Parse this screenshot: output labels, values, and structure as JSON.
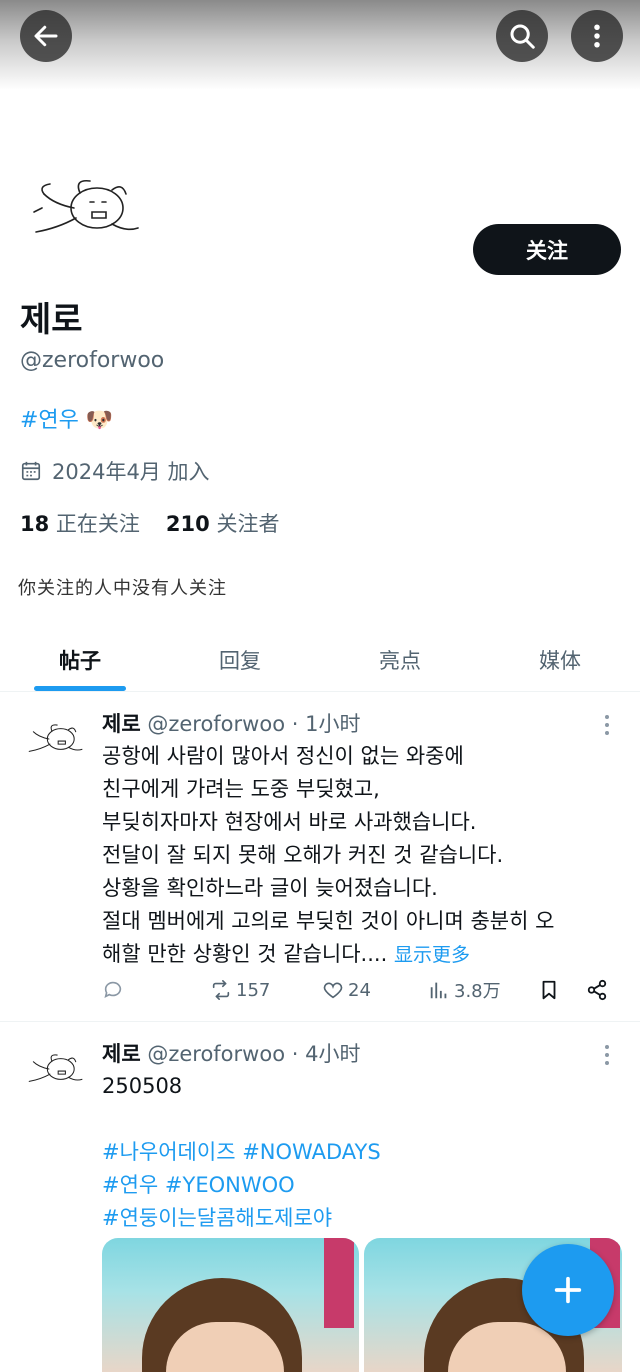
{
  "header": {
    "back_icon": "arrow-left-icon",
    "search_icon": "search-icon",
    "more_icon": "more-vertical-icon"
  },
  "profile": {
    "name": "제로",
    "handle": "@zeroforwoo",
    "bio_tag": "#연우",
    "bio_emoji": "🐶",
    "joined": "2024年4月 加入",
    "following_count": "18",
    "following_label": "正在关注",
    "followers_count": "210",
    "followers_label": "关注者",
    "followers_note": "你关注的人中没有人关注",
    "follow_label": "关注"
  },
  "tabs": [
    {
      "label": "帖子",
      "active": true
    },
    {
      "label": "回复",
      "active": false
    },
    {
      "label": "亮点",
      "active": false
    },
    {
      "label": "媒体",
      "active": false
    }
  ],
  "posts": [
    {
      "name": "제로",
      "handle": "@zeroforwoo",
      "time": "· 1小时",
      "lines": [
        "공항에 사람이 많아서 정신이 없는 와중에",
        "친구에게 가려는 도중 부딪혔고,",
        "부딪히자마자 현장에서 바로 사과했습니다.",
        "전달이 잘 되지 못해 오해가 커진 것 같습니다.",
        "상황을 확인하느라 글이 늦어졌습니다.",
        "절대 멤버에게 고의로 부딪힌 것이 아니며 충분히 오",
        "해할 만한 상황인 것 같습니다...."
      ],
      "show_more": "显示更多",
      "retweets": "157",
      "likes": "24",
      "views": "3.8万"
    },
    {
      "name": "제로",
      "handle": "@zeroforwoo",
      "time": "· 4小时",
      "text": "250508",
      "tags": [
        "#나우어데이즈 #NOWADAYS",
        "#연우 #YEONWOO",
        "#연둥이는달콤해도제로야"
      ]
    }
  ],
  "colors": {
    "accent": "#1d9bf0",
    "text": "#0f1419",
    "muted": "#536471"
  }
}
